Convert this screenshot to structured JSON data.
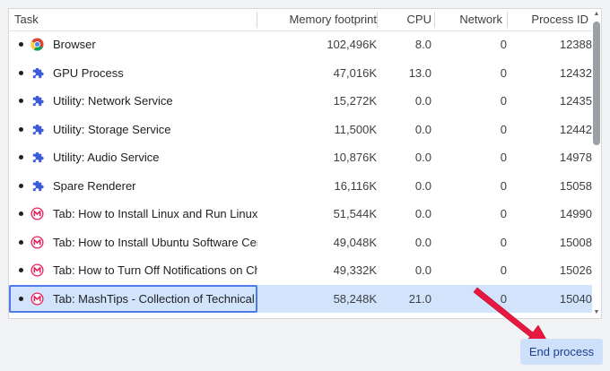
{
  "columns": {
    "task": "Task",
    "memory": "Memory footprint",
    "cpu": "CPU",
    "network": "Network",
    "pid": "Process ID"
  },
  "rows": [
    {
      "icon": "chrome-icon",
      "task": "Browser",
      "memory": "102,496K",
      "cpu": "8.0",
      "network": "0",
      "pid": "12388"
    },
    {
      "icon": "puzzle-piece-icon",
      "task": "GPU Process",
      "memory": "47,016K",
      "cpu": "13.0",
      "network": "0",
      "pid": "12432"
    },
    {
      "icon": "puzzle-piece-icon",
      "task": "Utility: Network Service",
      "memory": "15,272K",
      "cpu": "0.0",
      "network": "0",
      "pid": "12435"
    },
    {
      "icon": "puzzle-piece-icon",
      "task": "Utility: Storage Service",
      "memory": "11,500K",
      "cpu": "0.0",
      "network": "0",
      "pid": "12442"
    },
    {
      "icon": "puzzle-piece-icon",
      "task": "Utility: Audio Service",
      "memory": "10,876K",
      "cpu": "0.0",
      "network": "0",
      "pid": "14978"
    },
    {
      "icon": "puzzle-piece-icon",
      "task": "Spare Renderer",
      "memory": "16,116K",
      "cpu": "0.0",
      "network": "0",
      "pid": "15058"
    },
    {
      "icon": "mashtips-icon",
      "task": "Tab: How to Install Linux and Run Linux Ap",
      "memory": "51,544K",
      "cpu": "0.0",
      "network": "0",
      "pid": "14990"
    },
    {
      "icon": "mashtips-icon",
      "task": "Tab: How to Install Ubuntu Software Cente",
      "memory": "49,048K",
      "cpu": "0.0",
      "network": "0",
      "pid": "15008"
    },
    {
      "icon": "mashtips-icon",
      "task": "Tab: How to Turn Off Notifications on Chro",
      "memory": "49,332K",
      "cpu": "0.0",
      "network": "0",
      "pid": "15026"
    },
    {
      "icon": "mashtips-icon",
      "task": "Tab: MashTips - Collection of Technical Tip",
      "memory": "58,248K",
      "cpu": "21.0",
      "network": "0",
      "pid": "15040",
      "selected": true
    }
  ],
  "end_process_label": "End process",
  "colors": {
    "selection": "#d2e3fc",
    "focus_border": "#4f7be8",
    "puzzle_icon": "#3b5bdb",
    "mashtips_icon": "#e8245f",
    "annotation_arrow": "#e8173f",
    "button_bg": "#cfe0fb"
  }
}
